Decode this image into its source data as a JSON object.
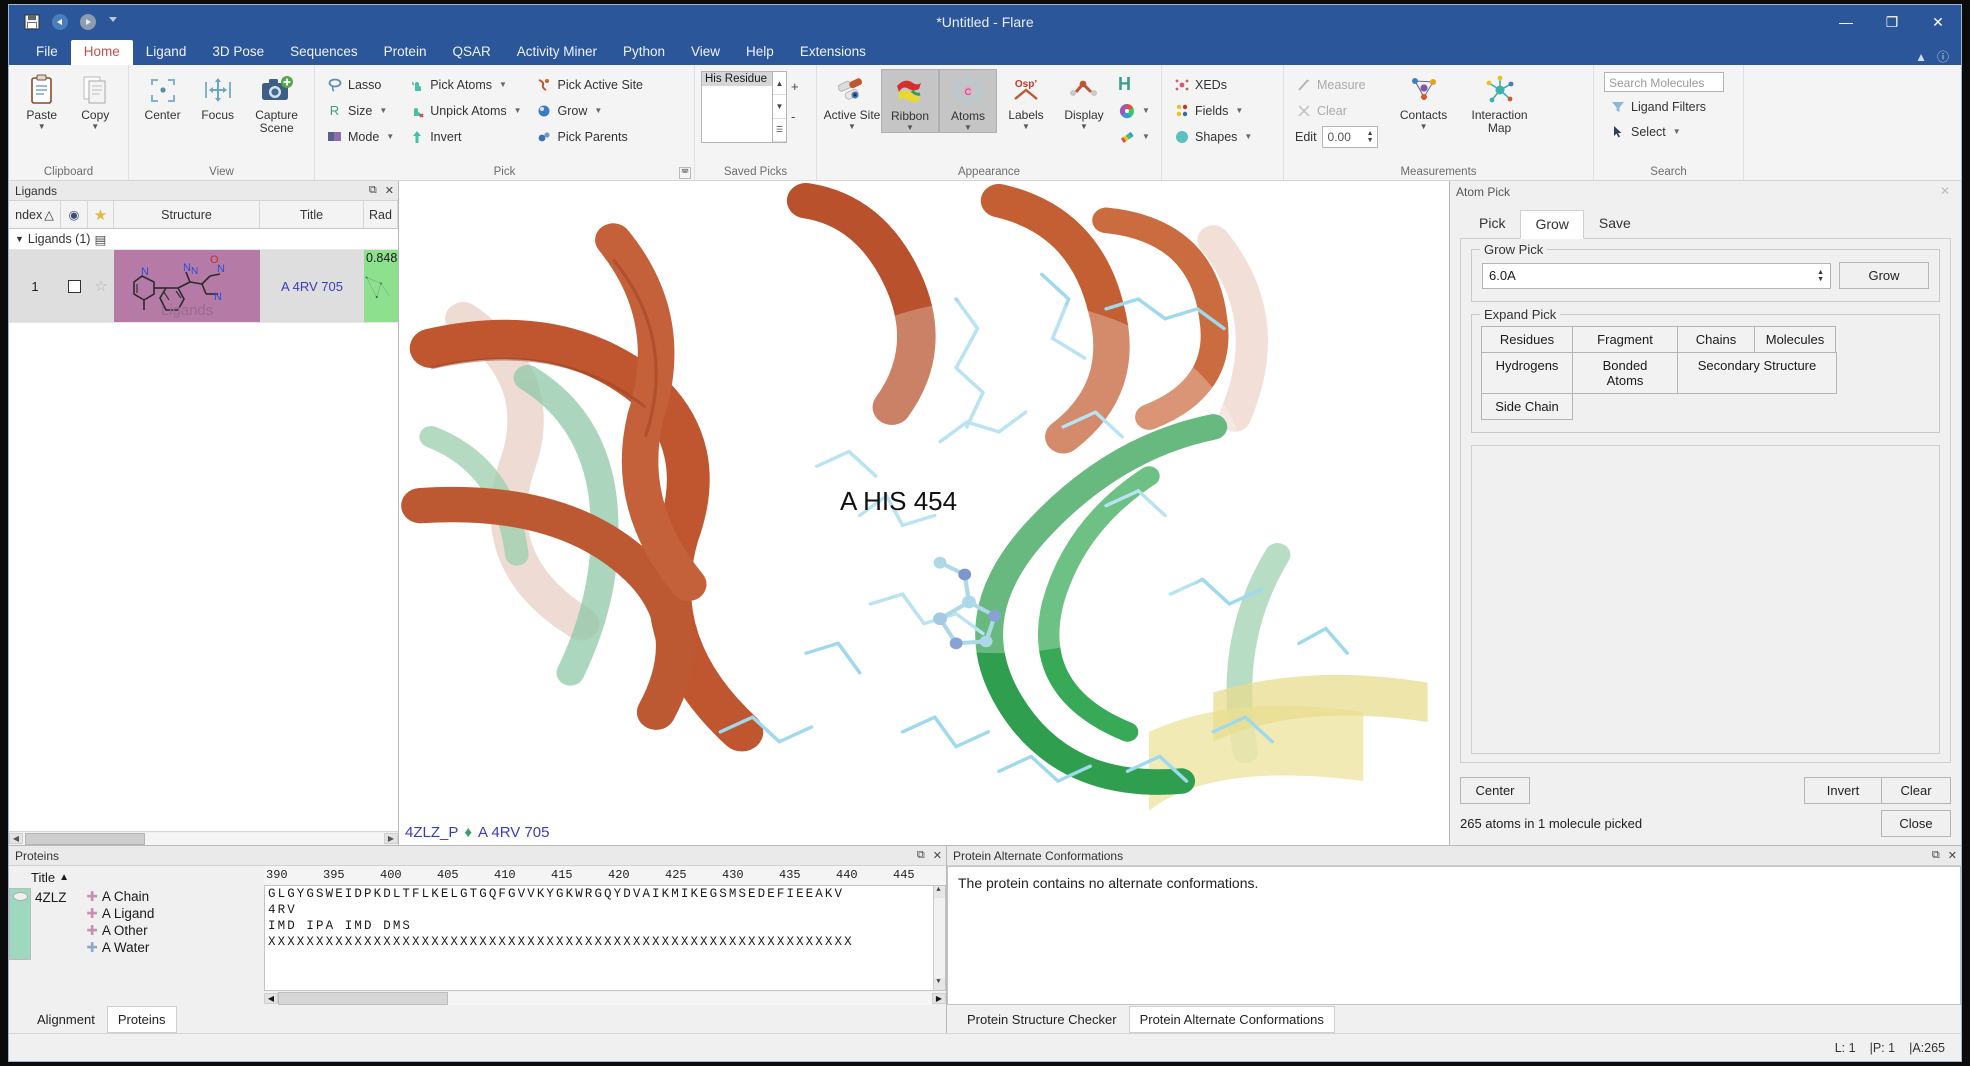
{
  "window": {
    "title": "*Untitled - Flare",
    "quick_access": [
      "save-icon",
      "undo-icon",
      "redo-icon",
      "customize-qat-icon"
    ],
    "controls": {
      "minimize": "—",
      "maximize": "❐",
      "close": "✕"
    }
  },
  "ribbon": {
    "tabs": [
      {
        "label": "File",
        "active": false
      },
      {
        "label": "Home",
        "active": true
      },
      {
        "label": "Ligand",
        "active": false
      },
      {
        "label": "3D Pose",
        "active": false
      },
      {
        "label": "Sequences",
        "active": false
      },
      {
        "label": "Protein",
        "active": false
      },
      {
        "label": "QSAR",
        "active": false
      },
      {
        "label": "Activity Miner",
        "active": false
      },
      {
        "label": "Python",
        "active": false
      },
      {
        "label": "View",
        "active": false
      },
      {
        "label": "Help",
        "active": false
      },
      {
        "label": "Extensions",
        "active": false
      }
    ],
    "right_icons": [
      "collapse-ribbon-icon",
      "help-icon"
    ],
    "groups": [
      {
        "name": "Clipboard",
        "label": "Clipboard",
        "big_buttons": [
          {
            "label": "Paste",
            "icon": "paste-icon",
            "has_dropdown": true
          },
          {
            "label": "Copy",
            "icon": "copy-icon",
            "has_dropdown": true
          }
        ]
      },
      {
        "name": "View",
        "label": "View",
        "big_buttons": [
          {
            "label": "Center",
            "icon": "center-icon",
            "has_dropdown": false
          },
          {
            "label": "Focus",
            "icon": "focus-icon",
            "has_dropdown": false
          },
          {
            "label": "Capture Scene",
            "icon": "camera-icon",
            "has_dropdown": false
          }
        ]
      },
      {
        "name": "Pick",
        "label": "Pick",
        "columns": [
          [
            {
              "label": "Lasso",
              "icon": "lasso-icon",
              "dropdown": false
            },
            {
              "label": "Size",
              "icon": "size-r-icon",
              "dropdown": true
            },
            {
              "label": "Mode",
              "icon": "mode-icon",
              "dropdown": true
            }
          ],
          [
            {
              "label": "Pick Atoms",
              "icon": "pick-atoms-icon",
              "dropdown": true
            },
            {
              "label": "Unpick Atoms",
              "icon": "unpick-atoms-icon",
              "dropdown": true
            },
            {
              "label": "Invert",
              "icon": "invert-icon",
              "dropdown": false
            }
          ],
          [
            {
              "label": "Pick Active Site",
              "icon": "pick-active-site-icon",
              "dropdown": false
            },
            {
              "label": "Grow",
              "icon": "grow-icon",
              "dropdown": true
            },
            {
              "label": "Pick Parents",
              "icon": "pick-parents-icon",
              "dropdown": false
            }
          ]
        ]
      },
      {
        "name": "Saved Picks",
        "label": "Saved Picks",
        "list_items": [
          "His Residue"
        ],
        "add_label": "+",
        "remove_label": "-"
      },
      {
        "name": "Appearance",
        "label": "Appearance",
        "big_buttons": [
          {
            "label": "Active Site",
            "icon": "active-site-icon",
            "has_dropdown": true,
            "toggled": false
          },
          {
            "label": "Ribbon",
            "icon": "ribbon-icon",
            "has_dropdown": true,
            "toggled": true
          },
          {
            "label": "Atoms",
            "icon": "atoms-icon",
            "has_dropdown": true,
            "toggled": true
          },
          {
            "label": "Labels",
            "icon": "labels-icon",
            "has_dropdown": true,
            "toggled": false
          },
          {
            "label": "Display",
            "icon": "display-icon",
            "has_dropdown": true,
            "toggled": false
          }
        ],
        "small_buttons": [
          {
            "label": "H",
            "icon": "hydrogen-icon",
            "dropdown": false
          },
          {
            "label": "",
            "icon": "color-wheel-icon",
            "dropdown": true
          },
          {
            "label": "",
            "icon": "style-icon",
            "dropdown": true
          }
        ]
      },
      {
        "name": "Fields",
        "label": "",
        "small_buttons": [
          {
            "label": "XEDs",
            "icon": "xeds-icon",
            "dropdown": false
          },
          {
            "label": "Fields",
            "icon": "fields-icon",
            "dropdown": true
          },
          {
            "label": "Shapes",
            "icon": "shapes-icon",
            "dropdown": true
          }
        ]
      },
      {
        "name": "Measurements",
        "label": "Measurements",
        "small_buttons": [
          {
            "label": "Measure",
            "icon": "measure-icon",
            "disabled": true
          },
          {
            "label": "Clear",
            "icon": "clear-measure-icon",
            "disabled": true
          }
        ],
        "edit_label": "Edit",
        "edit_value": "0.00",
        "big_buttons": [
          {
            "label": "Contacts",
            "icon": "contacts-icon",
            "has_dropdown": true
          },
          {
            "label": "Interaction Map",
            "icon": "interaction-map-icon",
            "has_dropdown": false
          }
        ]
      },
      {
        "name": "Search",
        "label": "Search",
        "search_placeholder": "Search Molecules",
        "search_value": "",
        "small_buttons": [
          {
            "label": "Ligand Filters",
            "icon": "filter-icon",
            "dropdown": false
          },
          {
            "label": "Select",
            "icon": "select-arrow-icon",
            "dropdown": true
          }
        ]
      }
    ]
  },
  "ligands_panel": {
    "title": "Ligands",
    "float_icon": "float-panel-icon",
    "close_icon": "close-panel-icon",
    "columns": [
      "Index",
      "◉",
      "★",
      "Structure",
      "Title",
      "Rad"
    ],
    "index_header": "ndex",
    "group_row": "Ligands (1)",
    "rows": [
      {
        "index": "1",
        "checkbox": false,
        "star": false,
        "structure_watermark": "Ligands",
        "title": "A 4RV 705",
        "radial_value": "0.848"
      }
    ]
  },
  "viewport": {
    "residue_label": "A HIS 454",
    "status_protein": "4ZLZ_P",
    "status_separator": "♦",
    "status_ligand": "A 4RV 705"
  },
  "atom_pick": {
    "title": "Atom Pick",
    "close_icon": "close-icon",
    "tabs": [
      {
        "label": "Pick",
        "active": false
      },
      {
        "label": "Grow",
        "active": true
      },
      {
        "label": "Save",
        "active": false
      }
    ],
    "grow_pick": {
      "legend": "Grow Pick",
      "distance_value": "6.0A",
      "grow_button": "Grow"
    },
    "expand_pick": {
      "legend": "Expand Pick",
      "buttons": [
        "Residues",
        "Fragment",
        "Chains",
        "Molecules",
        "Hydrogens",
        "Bonded Atoms",
        "Secondary Structure",
        "Side Chain"
      ]
    },
    "footer": {
      "center": "Center",
      "invert": "Invert",
      "clear": "Clear",
      "status": "265 atoms in 1 molecule picked",
      "close": "Close"
    }
  },
  "proteins_panel": {
    "title": "Proteins",
    "float_icon": "float-panel-icon",
    "close_icon": "close-panel-icon",
    "column_header": "Title",
    "sort_icon": "sort-asc-icon",
    "protein_name": "4ZLZ",
    "chain_items": [
      "A Chain",
      "A Ligand",
      "A Other",
      "A Water"
    ],
    "ruler_ticks": [
      "390",
      "395",
      "400",
      "405",
      "410",
      "415",
      "420",
      "425",
      "430",
      "435",
      "440",
      "445"
    ],
    "sequence_lines": [
      "GLGYGSWEIDPKDLTFLKELGTGQFGVVKYGKWRGQYDVAIKMIKEGSMSEDEFIEEAKV",
      "4RV",
      "IMD IPA IMD DMS",
      "XXXXXXXXXXXXXXXXXXXXXXXXXXXXXXXXXXXXXXXXXXXXXXXXXXXXXXXXXXXXX"
    ],
    "tabs": [
      {
        "label": "Alignment",
        "active": false
      },
      {
        "label": "Proteins",
        "active": true
      }
    ]
  },
  "conformations_panel": {
    "title": "Protein Alternate Conformations",
    "float_icon": "float-panel-icon",
    "close_icon": "close-panel-icon",
    "message": "The protein contains no alternate conformations.",
    "tabs": [
      {
        "label": "Protein Structure Checker",
        "active": false
      },
      {
        "label": "Protein Alternate Conformations",
        "active": true
      }
    ]
  },
  "status_bar": {
    "ligands": "L: 1",
    "proteins": "|P: 1",
    "atoms": "|A:265"
  },
  "colors": {
    "title_blue": "#2b579a",
    "accent_red": "#c0504d",
    "ligand_purple": "#b57ba6",
    "radial_green": "#8de08d",
    "helix_orange": "#c0562f",
    "helix_green": "#2f9e4f",
    "atom_cyan": "#9fd9ee",
    "label_blue": "#3b3bbf"
  }
}
